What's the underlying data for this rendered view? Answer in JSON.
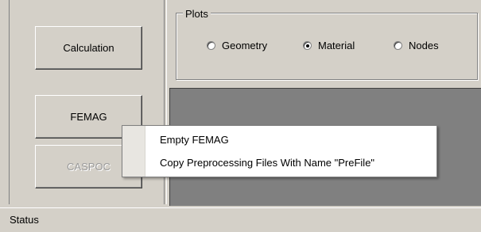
{
  "left_panel": {
    "calculation_label": "Calculation",
    "femag_label": "FEMAG",
    "caspoc_label": "CASPOC"
  },
  "plots": {
    "title": "Plots",
    "options": [
      {
        "label": "Geometry",
        "checked": false
      },
      {
        "label": "Material",
        "checked": true
      },
      {
        "label": "Nodes",
        "checked": false
      }
    ]
  },
  "context_menu": {
    "items": [
      {
        "label": "Empty FEMAG"
      },
      {
        "label": "Copy Preprocessing Files With Name \"PreFile\""
      }
    ]
  },
  "status_bar": {
    "text": "Status"
  }
}
